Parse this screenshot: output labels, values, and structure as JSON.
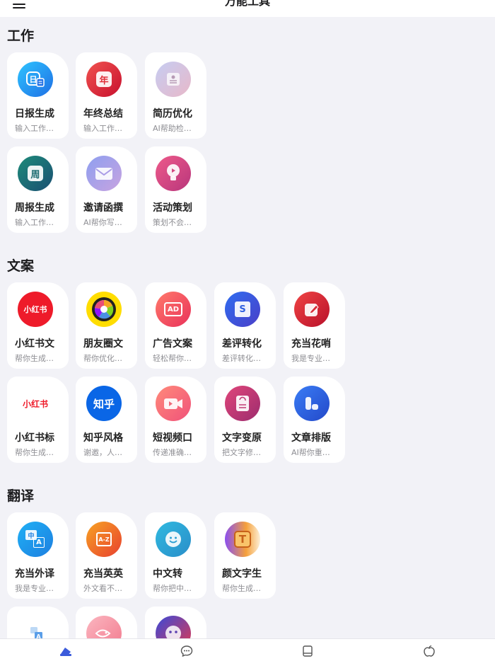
{
  "header": {
    "title": "万能工具"
  },
  "sections": [
    {
      "title": "工作",
      "cards": [
        {
          "name": "日报生成",
          "desc": "输入工作…",
          "icon": "daily-report-icon"
        },
        {
          "name": "年终总结",
          "desc": "输入工作…",
          "icon": "year-end-icon"
        },
        {
          "name": "简历优化",
          "desc": "AI帮助检…",
          "icon": "resume-icon"
        },
        {
          "name": "周报生成",
          "desc": "输入工作…",
          "icon": "weekly-report-icon"
        },
        {
          "name": "邀请函撰",
          "desc": "AI帮你写…",
          "icon": "envelope-icon"
        },
        {
          "name": "活动策划",
          "desc": "策划不会…",
          "icon": "lightbulb-icon"
        }
      ]
    },
    {
      "title": "文案",
      "cards": [
        {
          "name": "小红书文",
          "desc": "帮你生成…",
          "icon": "xiaohongshu-icon"
        },
        {
          "name": "朋友圈文",
          "desc": "帮你优化…",
          "icon": "aperture-icon"
        },
        {
          "name": "广告文案",
          "desc": "轻松帮你…",
          "icon": "ad-tv-icon"
        },
        {
          "name": "差评转化",
          "desc": "差评转化…",
          "icon": "s-logo-icon"
        },
        {
          "name": "充当花哨",
          "desc": "我是专业…",
          "icon": "edit-icon"
        },
        {
          "name": "小红书标",
          "desc": "帮你生成…",
          "icon": "xiaohongshu-logo-icon"
        },
        {
          "name": "知乎风格",
          "desc": "谢邀，人…",
          "icon": "zhihu-icon"
        },
        {
          "name": "短视频口",
          "desc": "传递准确…",
          "icon": "video-camera-icon"
        },
        {
          "name": "文字变原",
          "desc": "把文字修…",
          "icon": "document-refresh-icon"
        },
        {
          "name": "文章排版",
          "desc": "AI帮你重…",
          "icon": "layout-icon"
        }
      ]
    },
    {
      "title": "翻译",
      "cards": [
        {
          "name": "充当外译",
          "desc": "我是专业…",
          "icon": "translate-icon"
        },
        {
          "name": "充当英英",
          "desc": "外文看不…",
          "icon": "dictionary-icon"
        },
        {
          "name": "中文转",
          "desc": "帮你把中…",
          "icon": "smile-icon"
        },
        {
          "name": "颜文字生",
          "desc": "帮你生成…",
          "icon": "letter-t-icon"
        },
        {
          "name": "",
          "desc": "",
          "icon": "translate-small-icon"
        },
        {
          "name": "",
          "desc": "",
          "icon": "fish-icon"
        },
        {
          "name": "",
          "desc": "",
          "icon": "emoji-face-icon"
        }
      ]
    }
  ],
  "icon_text": {
    "ri": "日",
    "nian": "年",
    "zhou": "周",
    "xhs": "小红书",
    "xhs2": "小红书",
    "zhihu": "知乎",
    "ad": "AD",
    "s": "S",
    "t": "T",
    "zh": "中",
    "a": "A",
    "az": "A-Z"
  },
  "tabbar": [
    {
      "icon": "toolbox-icon",
      "active": true
    },
    {
      "icon": "chat-icon",
      "active": false
    },
    {
      "icon": "book-icon",
      "active": false
    },
    {
      "icon": "apple-icon",
      "active": false
    }
  ],
  "colors": {
    "accent": "#3b5bdb",
    "background": "#f2f2f7"
  }
}
